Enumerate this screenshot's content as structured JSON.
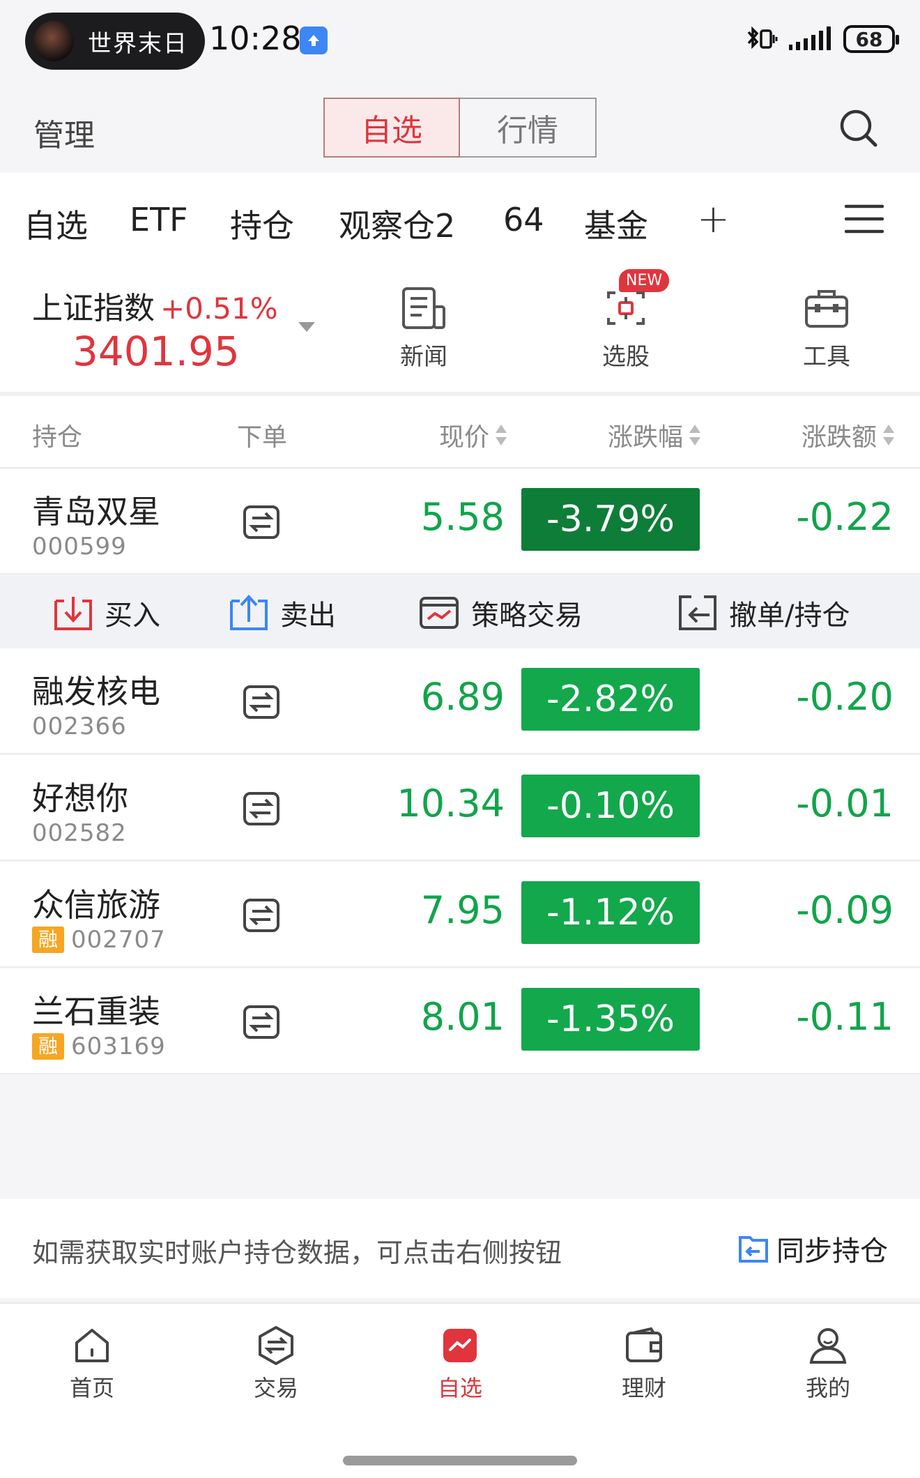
{
  "status": {
    "music_title": "世界末日",
    "time": "10:28",
    "battery": "68"
  },
  "header": {
    "manage_label": "管理",
    "segments": [
      "自选",
      "行情"
    ],
    "active_segment": "自选"
  },
  "tabs": [
    "自选",
    "ETF",
    "持仓",
    "观察仓2",
    "64",
    "基金"
  ],
  "active_tab": "持仓",
  "index": {
    "name": "上证指数",
    "change": "+0.51%",
    "value": "3401.95"
  },
  "quick_actions": [
    {
      "label": "新闻",
      "icon": "news-icon"
    },
    {
      "label": "选股",
      "icon": "stock-picker-icon",
      "badge": "NEW"
    },
    {
      "label": "工具",
      "icon": "toolbox-icon"
    }
  ],
  "columns": {
    "holding": "持仓",
    "order": "下单",
    "price": "现价",
    "change_pct": "涨跌幅",
    "change_amt": "涨跌额"
  },
  "rows": [
    {
      "name": "青岛双星",
      "code": "000599",
      "rong": false,
      "price": "5.58",
      "pct": "-3.79%",
      "amt": "-0.22"
    },
    {
      "name": "融发核电",
      "code": "002366",
      "rong": false,
      "price": "6.89",
      "pct": "-2.82%",
      "amt": "-0.20"
    },
    {
      "name": "好想你",
      "code": "002582",
      "rong": false,
      "price": "10.34",
      "pct": "-0.10%",
      "amt": "-0.01"
    },
    {
      "name": "众信旅游",
      "code": "002707",
      "rong": true,
      "price": "7.95",
      "pct": "-1.12%",
      "amt": "-0.09"
    },
    {
      "name": "兰石重装",
      "code": "603169",
      "rong": true,
      "price": "8.01",
      "pct": "-1.35%",
      "amt": "-0.11"
    }
  ],
  "rong_label": "融",
  "row_actions": [
    {
      "label": "买入",
      "icon": "buy-icon"
    },
    {
      "label": "卖出",
      "icon": "sell-icon"
    },
    {
      "label": "策略交易",
      "icon": "strategy-icon"
    },
    {
      "label": "撤单/持仓",
      "icon": "cancel-order-icon"
    }
  ],
  "sync": {
    "hint": "如需获取实时账户持仓数据，可点击右侧按钮",
    "button": "同步持仓"
  },
  "nav": [
    {
      "label": "首页",
      "icon": "home-icon"
    },
    {
      "label": "交易",
      "icon": "trade-icon"
    },
    {
      "label": "自选",
      "icon": "watchlist-icon"
    },
    {
      "label": "理财",
      "icon": "wallet-icon"
    },
    {
      "label": "我的",
      "icon": "profile-icon"
    }
  ],
  "active_nav": "自选",
  "colors": {
    "accent_red": "#e0353d",
    "down_green": "#12a84b",
    "down_green_dark": "#0d7d38",
    "rong_orange": "#f6a623"
  }
}
